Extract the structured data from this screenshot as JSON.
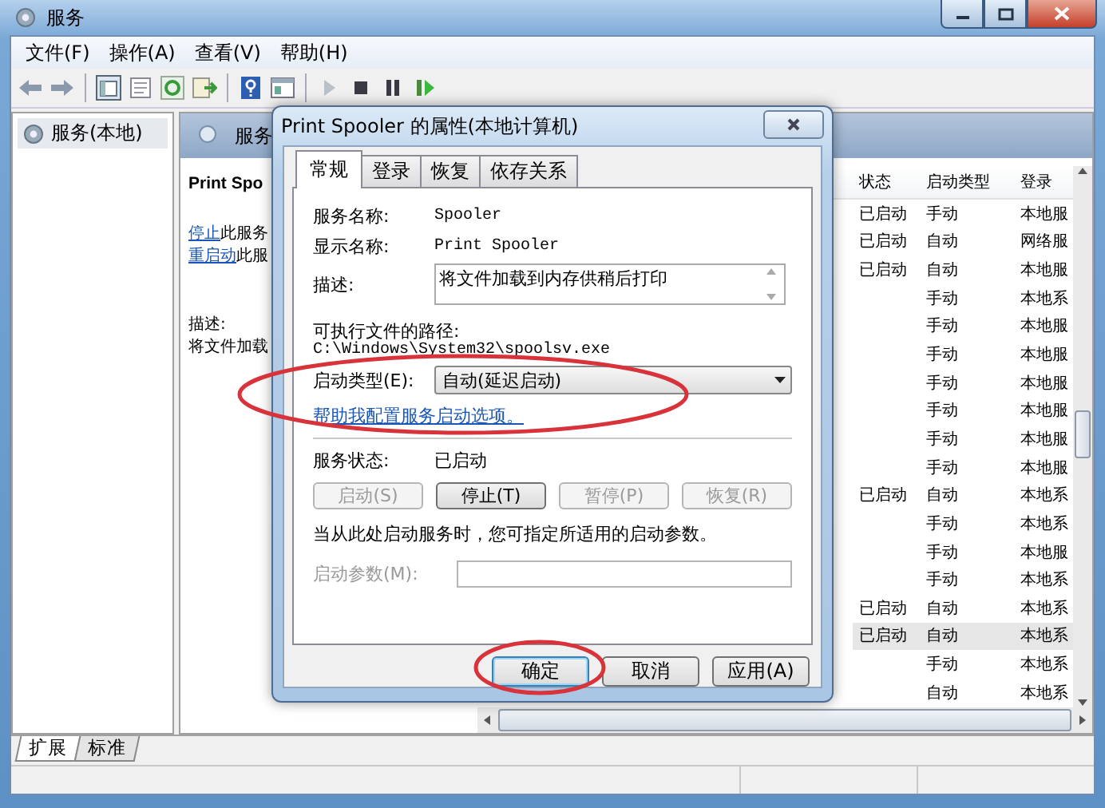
{
  "window": {
    "title": "服务"
  },
  "menu": [
    "文件(F)",
    "操作(A)",
    "查看(V)",
    "帮助(H)"
  ],
  "tree": {
    "items": [
      {
        "label": "服务(本地)",
        "selected": true
      }
    ]
  },
  "services_pane": {
    "header": "服务",
    "detail": {
      "title": "Print Spo",
      "links": [
        {
          "link": "停止",
          "rest": "此服务"
        },
        {
          "link": "重启动",
          "rest": "此服"
        }
      ],
      "description_label": "描述:",
      "description": "将文件加载"
    }
  },
  "list": {
    "columns": [
      "状态",
      "启动类型",
      "登录"
    ],
    "rows": [
      {
        "status": "已启动",
        "startup": "手动",
        "logon": "本地服",
        "selected": false
      },
      {
        "status": "已启动",
        "startup": "自动",
        "logon": "网络服",
        "selected": false
      },
      {
        "status": "已启动",
        "startup": "自动",
        "logon": "本地服",
        "selected": false
      },
      {
        "status": "",
        "startup": "手动",
        "logon": "本地系",
        "selected": false
      },
      {
        "status": "",
        "startup": "手动",
        "logon": "本地服",
        "selected": false
      },
      {
        "status": "",
        "startup": "手动",
        "logon": "本地服",
        "selected": false
      },
      {
        "status": "",
        "startup": "手动",
        "logon": "本地服",
        "selected": false
      },
      {
        "status": "",
        "startup": "手动",
        "logon": "本地服",
        "selected": false
      },
      {
        "status": "",
        "startup": "手动",
        "logon": "本地服",
        "selected": false
      },
      {
        "status": "",
        "startup": "手动",
        "logon": "本地服",
        "selected": false
      },
      {
        "status": "已启动",
        "startup": "自动",
        "logon": "本地系",
        "selected": false
      },
      {
        "status": "",
        "startup": "手动",
        "logon": "本地系",
        "selected": false
      },
      {
        "status": "",
        "startup": "手动",
        "logon": "本地服",
        "selected": false
      },
      {
        "status": "",
        "startup": "手动",
        "logon": "本地系",
        "selected": false
      },
      {
        "status": "已启动",
        "startup": "自动",
        "logon": "本地系",
        "selected": false
      },
      {
        "status": "已启动",
        "startup": "自动",
        "logon": "本地系",
        "selected": true
      },
      {
        "status": "",
        "startup": "手动",
        "logon": "本地系",
        "selected": false
      },
      {
        "status": "",
        "startup": "自动",
        "logon": "本地系",
        "selected": false
      }
    ]
  },
  "view_tabs": [
    {
      "label": "扩展",
      "selected": true
    },
    {
      "label": "标准",
      "selected": false
    }
  ],
  "dialog": {
    "title": "Print Spooler 的属性(本地计算机)",
    "tabs": [
      {
        "label": "常规",
        "selected": true
      },
      {
        "label": "登录",
        "selected": false
      },
      {
        "label": "恢复",
        "selected": false
      },
      {
        "label": "依存关系",
        "selected": false
      }
    ],
    "fields": [
      {
        "label": "服务名称:",
        "value": "Spooler"
      },
      {
        "label": "显示名称:",
        "value": "Print Spooler"
      }
    ],
    "description": {
      "label": "描述:",
      "value": "将文件加载到内存供稍后打印"
    },
    "path": {
      "label": "可执行文件的路径:",
      "value": "C:\\Windows\\System32\\spoolsv.exe"
    },
    "startup_type": {
      "label": "启动类型(E):",
      "value": "自动(延迟启动)"
    },
    "help_link": "帮助我配置服务启动选项。",
    "status": {
      "label": "服务状态:",
      "value": "已启动"
    },
    "control_buttons": [
      {
        "label": "启动(S)",
        "disabled": true
      },
      {
        "label": "停止(T)",
        "disabled": false
      },
      {
        "label": "暂停(P)",
        "disabled": true
      },
      {
        "label": "恢复(R)",
        "disabled": true
      }
    ],
    "hint": "当从此处启动服务时，您可指定所适用的启动参数。",
    "params": {
      "label": "启动参数(M):",
      "disabled": true
    },
    "buttons": [
      "确定",
      "取消",
      "应用(A)"
    ]
  }
}
